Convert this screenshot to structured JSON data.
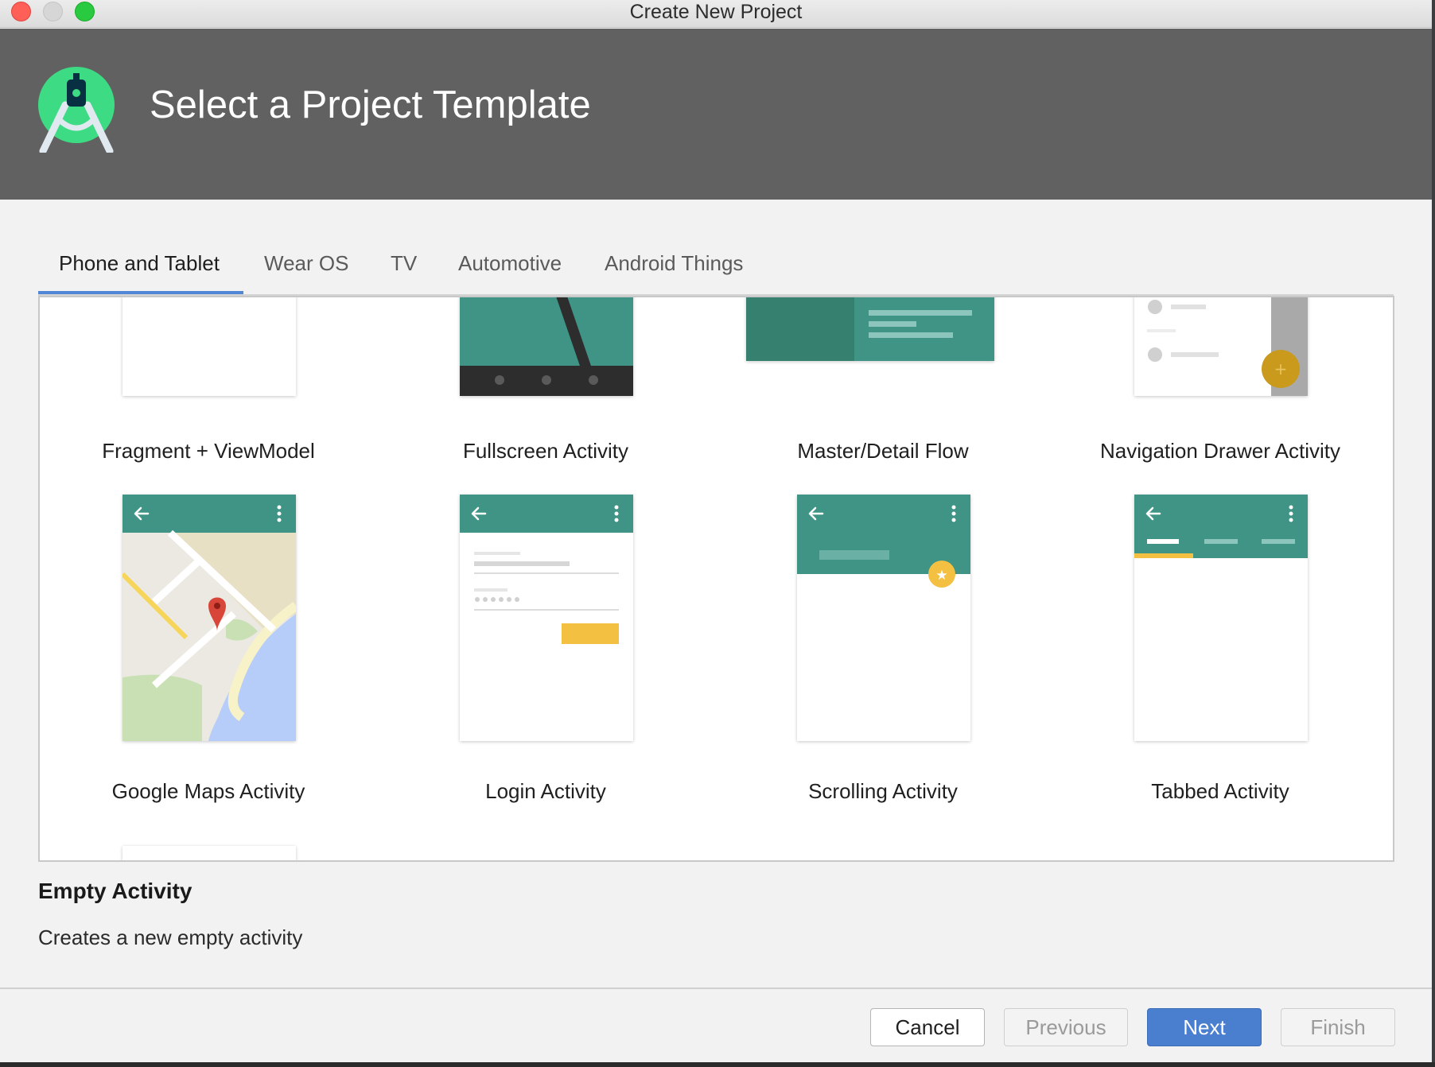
{
  "window": {
    "title": "Create New Project"
  },
  "header": {
    "title": "Select a Project Template"
  },
  "tabs": [
    {
      "label": "Phone and Tablet",
      "active": true
    },
    {
      "label": "Wear OS"
    },
    {
      "label": "TV"
    },
    {
      "label": "Automotive"
    },
    {
      "label": "Android Things"
    }
  ],
  "templates": [
    {
      "name": "Fragment + ViewModel"
    },
    {
      "name": "Fullscreen Activity"
    },
    {
      "name": "Master/Detail Flow"
    },
    {
      "name": "Navigation Drawer Activity"
    },
    {
      "name": "Google Maps Activity"
    },
    {
      "name": "Login Activity"
    },
    {
      "name": "Scrolling Activity"
    },
    {
      "name": "Tabbed Activity"
    }
  ],
  "selected": {
    "title": "Empty Activity",
    "description": "Creates a new empty activity"
  },
  "buttons": {
    "cancel": "Cancel",
    "previous": "Previous",
    "next": "Next",
    "finish": "Finish"
  },
  "colors": {
    "teal": "#3f9486",
    "header": "#616161",
    "accent_blue": "#4a7ece",
    "amber": "#f4c042"
  }
}
